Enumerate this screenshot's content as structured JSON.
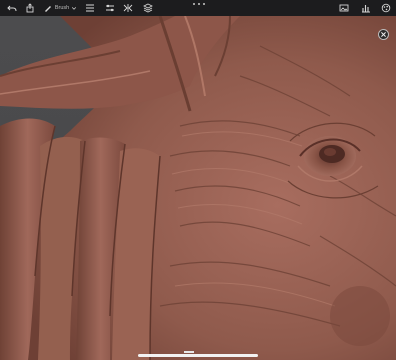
{
  "toolbar": {
    "brush_label": "Brush"
  },
  "icons": [
    "undo-icon",
    "share-icon",
    "brush-icon",
    "chevron-down-icon",
    "list-icon",
    "symmetry-icon",
    "layers-icon",
    "more-icon",
    "image-icon",
    "stats-icon",
    "palette-icon",
    "close-icon"
  ],
  "colors": {
    "toolbar_bg": "#1c1c1e",
    "clay": "#8e5b4e",
    "background": "#4a4a4c"
  }
}
